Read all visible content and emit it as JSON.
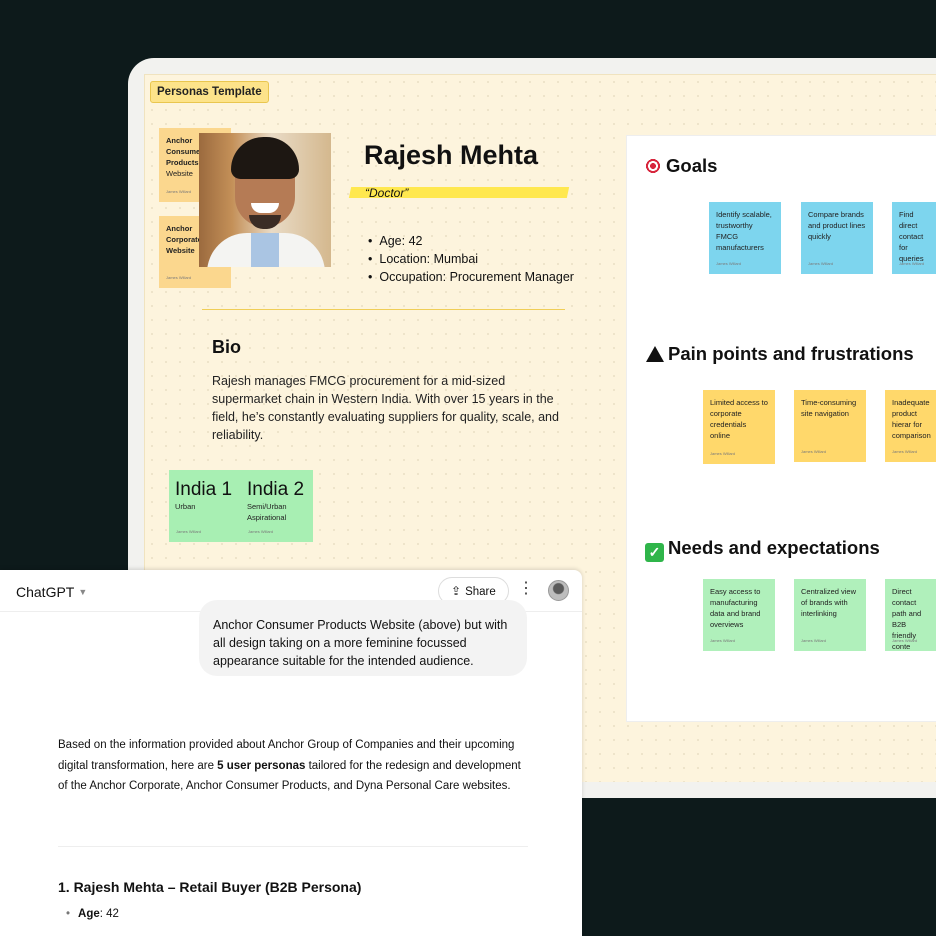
{
  "board": {
    "template_tag": "Personas Template",
    "profile_stickies": [
      {
        "title": "Anchor Consumer Products",
        "subtitle": "Website",
        "author": "James Willard"
      },
      {
        "title": "Anchor Corporate Website",
        "subtitle": "",
        "author": "James Willard"
      }
    ],
    "persona": {
      "name": "Rajesh Mehta",
      "role": "“Doctor”",
      "facts": [
        "Age: 42",
        "Location: Mumbai",
        "Occupation: Procurement Manager"
      ],
      "bio_title": "Bio",
      "bio": "Rajesh manages FMCG procurement for a mid-sized supermarket chain in Western India. With over 15 years in the field, he’s constantly evaluating suppliers for quality, scale, and reliability."
    },
    "region_stickies": [
      {
        "title": "India 1",
        "subtitle": "Urban",
        "author": "James Willard"
      },
      {
        "title": "India 2",
        "subtitle": "Semi/Urban Aspirational",
        "author": "James Willard"
      }
    ],
    "goals": {
      "title": "Goals",
      "stickies": [
        "Identify scalable, trustworthy FMCG manufacturers",
        "Compare brands and product lines quickly",
        "Find direct contact for queries"
      ]
    },
    "pain_points": {
      "title": "Pain points and frustrations",
      "stickies": [
        "Limited access to corporate credentials online",
        "Time-consuming site navigation",
        "Inadequate product hierar for comparison"
      ]
    },
    "needs": {
      "title": "Needs and expectations",
      "stickies": [
        "Easy access to manufacturing data and brand overviews",
        "Centralized view of brands with interlinking",
        "Direct contact path and B2B friendly conte"
      ]
    },
    "sticky_author": "James Willard"
  },
  "chat": {
    "title": "ChatGPT",
    "share_label": "Share",
    "user_message": "Anchor Consumer Products Website (above) but with all design taking on a more feminine focussed appearance suitable for the intended audience.",
    "answer_pre": "Based on the information provided about Anchor Group of Companies and their upcoming digital transformation, here are ",
    "answer_bold": "5 user personas",
    "answer_post": " tailored for the redesign and development of the Anchor Corporate, Anchor Consumer Products, and Dyna Personal Care websites.",
    "persona_heading": "1. Rajesh Mehta – Retail Buyer (B2B Persona)",
    "age_label": "Age",
    "age_value": ": 42"
  },
  "colors": {
    "background": "#0d1a1b",
    "board": "#fdf4dd",
    "highlight": "#ffe84f",
    "sticky_yellow": "#ffd86b",
    "sticky_blue": "#7dd5ee",
    "sticky_green": "#a8efb3"
  }
}
